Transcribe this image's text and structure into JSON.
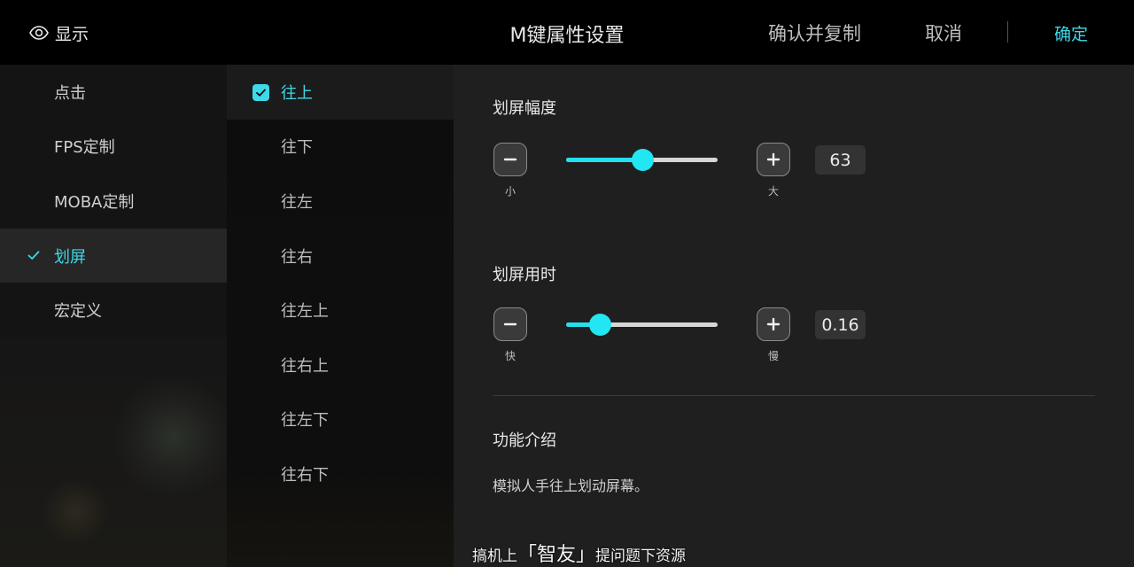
{
  "topbar": {
    "show_label": "显示",
    "title": "M键属性设置",
    "confirm_copy_label": "确认并复制",
    "cancel_label": "取消",
    "ok_label": "确定"
  },
  "categories": [
    {
      "label": "点击",
      "active": false
    },
    {
      "label": "FPS定制",
      "active": false
    },
    {
      "label": "MOBA定制",
      "active": false
    },
    {
      "label": "划屏",
      "active": true
    },
    {
      "label": "宏定义",
      "active": false
    }
  ],
  "directions": [
    {
      "label": "往上",
      "checked": true
    },
    {
      "label": "往下",
      "checked": false
    },
    {
      "label": "往左",
      "checked": false
    },
    {
      "label": "往右",
      "checked": false
    },
    {
      "label": "往左上",
      "checked": false
    },
    {
      "label": "往右上",
      "checked": false
    },
    {
      "label": "往左下",
      "checked": false
    },
    {
      "label": "往右下",
      "checked": false
    }
  ],
  "swipe_amplitude": {
    "label": "划屏幅度",
    "min_caption": "小",
    "max_caption": "大",
    "value": "63",
    "slider_fraction": 0.5
  },
  "swipe_duration": {
    "label": "划屏用时",
    "min_caption": "快",
    "max_caption": "慢",
    "value": "0.16",
    "slider_fraction": 0.22
  },
  "intro": {
    "label": "功能介绍",
    "text": "模拟人手往上划动屏幕。"
  },
  "watermark": {
    "prefix": "搞机上",
    "brand": "「智友」",
    "suffix": "提问题下资源"
  },
  "colors": {
    "accent": "#3ed8e8",
    "slider_fill": "#22e0ee"
  }
}
